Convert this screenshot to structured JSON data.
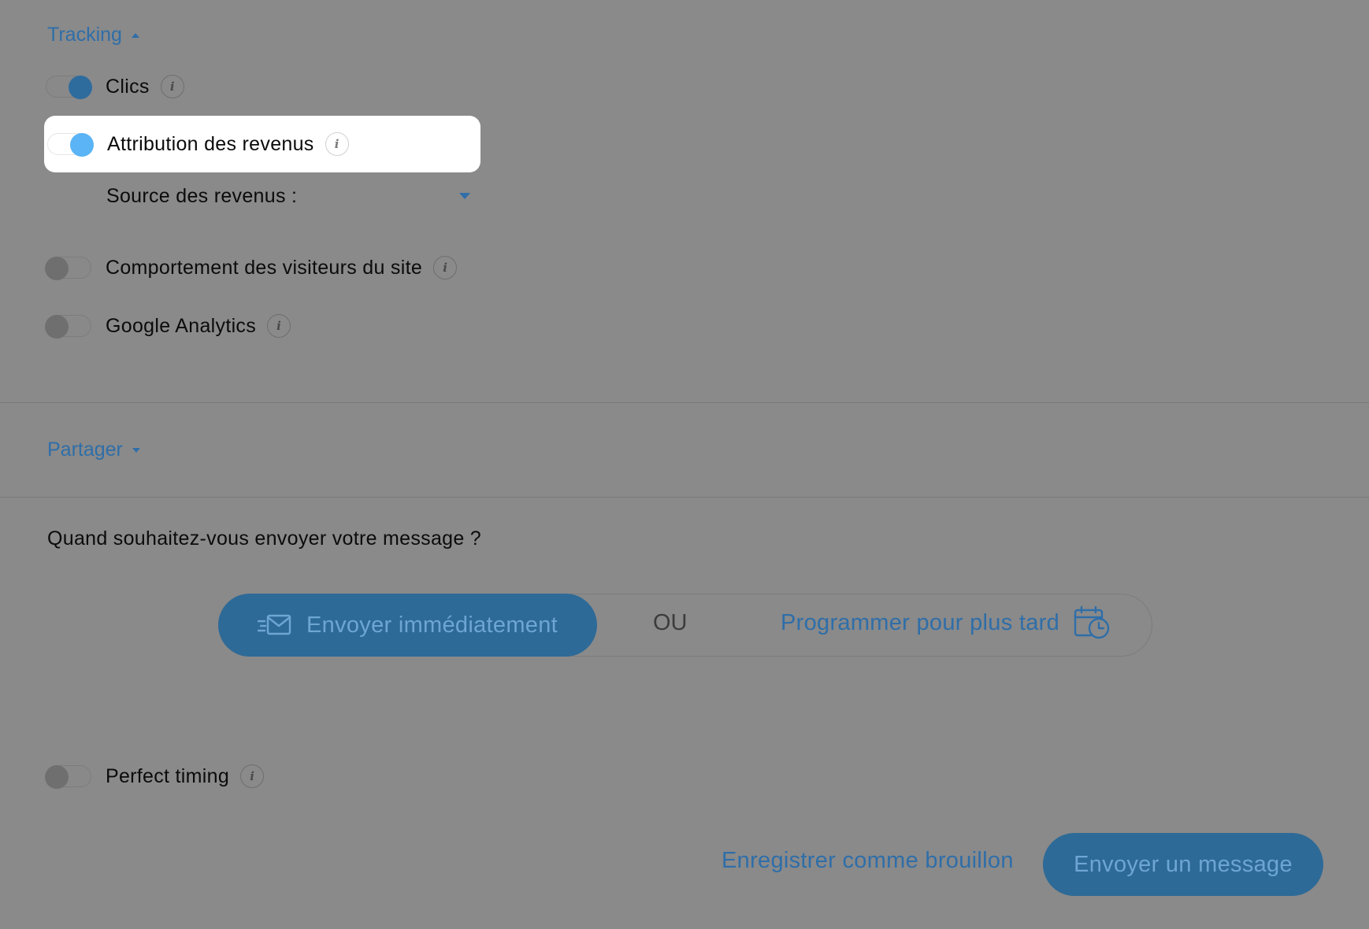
{
  "tracking": {
    "title": "Tracking",
    "items": [
      {
        "label": "Clics",
        "enabled": true
      },
      {
        "label": "Attribution des revenus",
        "enabled": true
      },
      {
        "label": "Comportement des visiteurs du site",
        "enabled": false
      },
      {
        "label": "Google Analytics",
        "enabled": false
      }
    ],
    "revenue_source_label": "Source des revenus :",
    "info_glyph": "i"
  },
  "share": {
    "title": "Partager"
  },
  "schedule": {
    "question": "Quand souhaitez-vous envoyer votre message ?",
    "send_now_label": "Envoyer immédiatement",
    "or_label": "OU",
    "later_label": "Programmer pour plus tard"
  },
  "perfect_timing": {
    "label": "Perfect timing",
    "enabled": false
  },
  "footer": {
    "draft_label": "Enregistrer comme brouillon",
    "send_label": "Envoyer un message"
  },
  "colors": {
    "accent": "#2f6ea8",
    "overlay_bg": "#8a8a8a",
    "highlight_knob": "#5ab4f5"
  }
}
